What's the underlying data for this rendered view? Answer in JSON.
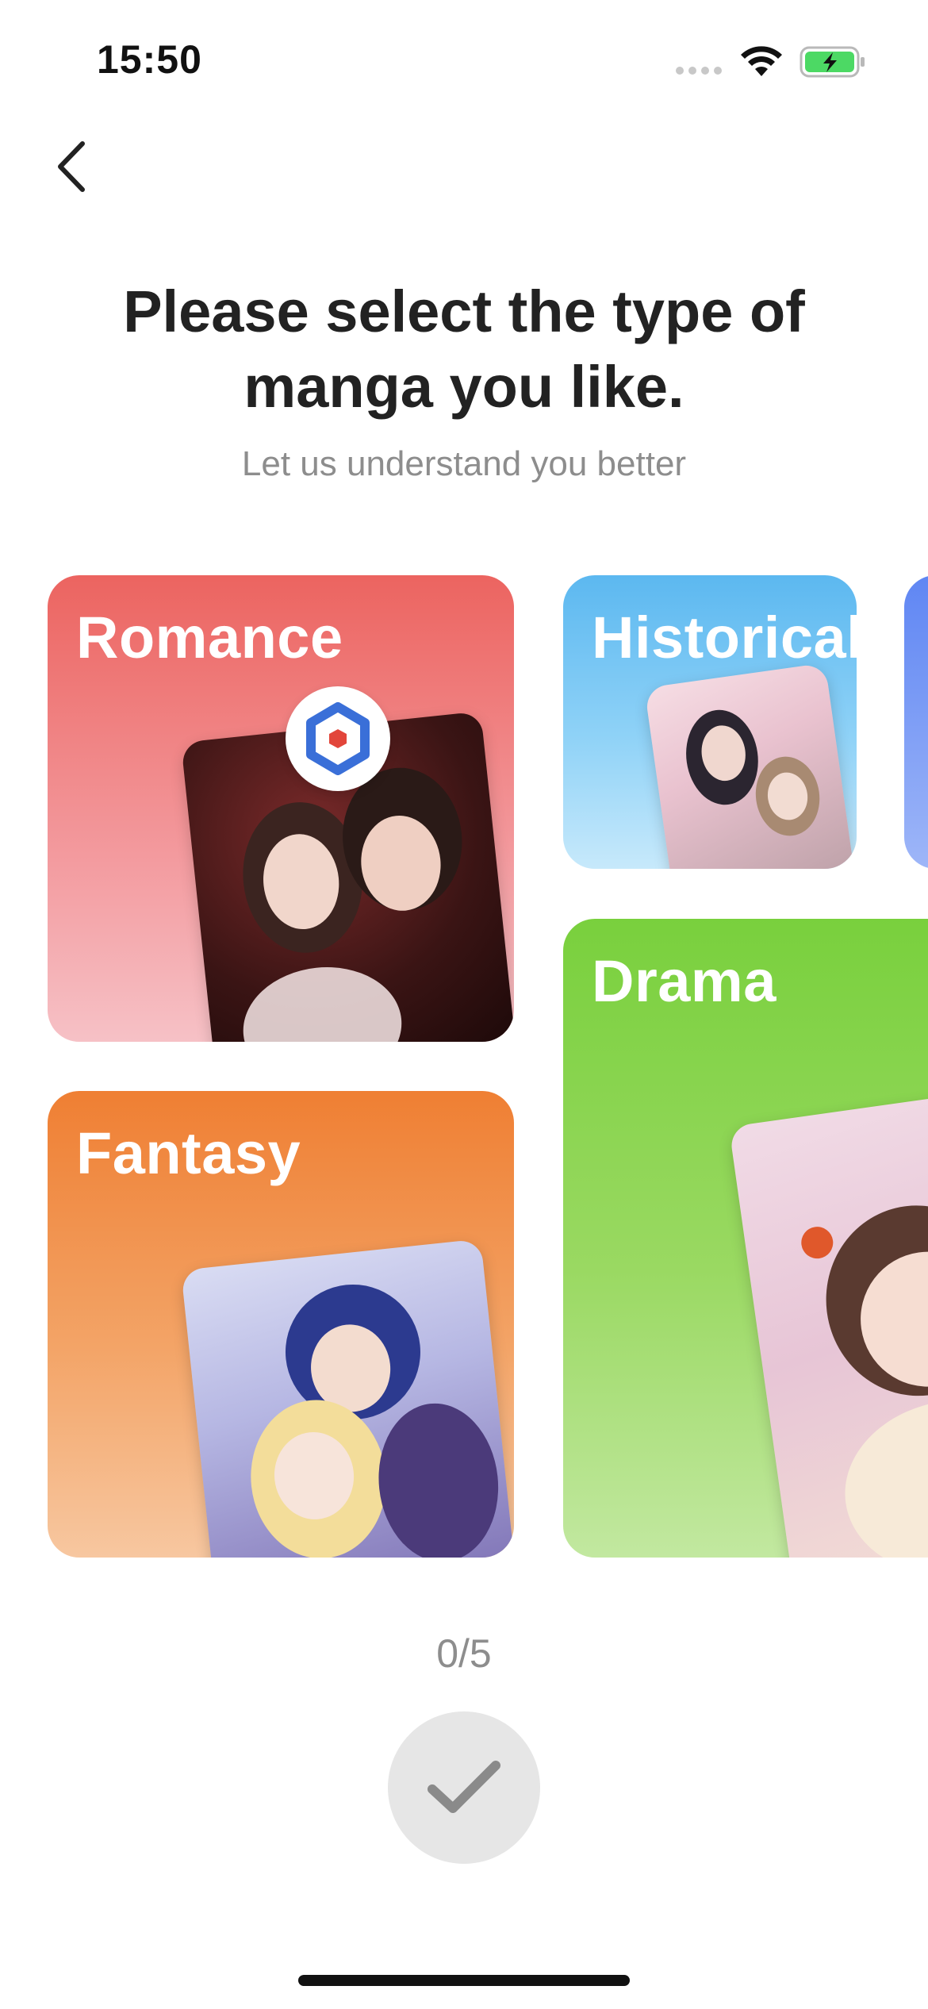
{
  "status_bar": {
    "time": "15:50"
  },
  "header": {
    "title": "Please select the type of manga you like.",
    "subtitle": "Let us understand you better"
  },
  "genres": [
    {
      "label": "Romance",
      "color": "#ec6460"
    },
    {
      "label": "Historical",
      "color": "#5cb8f0"
    },
    {
      "label": "Drama",
      "color": "#79d03d"
    },
    {
      "label": "Fantasy",
      "color": "#ef7f33"
    }
  ],
  "selection": {
    "counter": "0/5"
  },
  "colors": {
    "confirm_disabled": "#e6e6e6",
    "confirm_check": "#8a8a8a",
    "battery": "#4cd964"
  },
  "icons": {
    "back": "chevron-left-icon",
    "confirm": "checkmark-icon",
    "badge": "hexagon-logo-icon"
  }
}
